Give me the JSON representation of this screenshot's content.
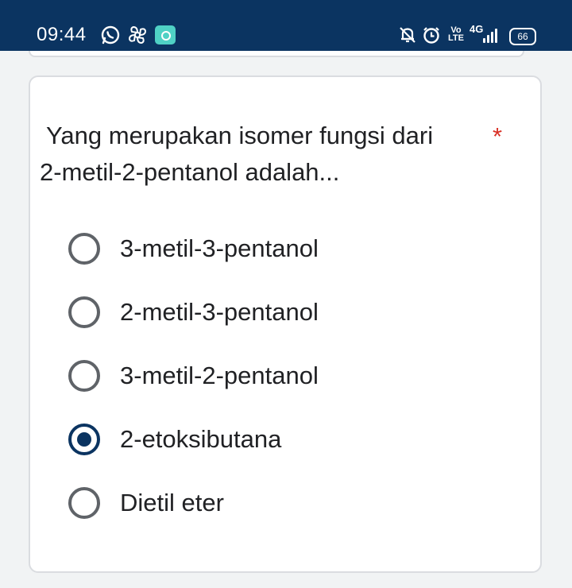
{
  "status_bar": {
    "time": "09:44",
    "left_icons": [
      "whatsapp-icon",
      "pinwheel-icon",
      "app-notification-icon"
    ],
    "right_icons": [
      "mute-bell-icon",
      "alarm-icon",
      "volte-icon",
      "signal-icon",
      "battery-icon"
    ],
    "volte_top": "Vo",
    "volte_bottom": "LTE",
    "network_type": "4G",
    "battery_level": "66"
  },
  "question": {
    "line1": " Yang merupakan isomer fungsi dari",
    "line2": "2-metil-2-pentanol adalah...",
    "required_marker": "*"
  },
  "options": [
    {
      "label": "3-metil-3-pentanol",
      "selected": false
    },
    {
      "label": "2-metil-3-pentanol",
      "selected": false
    },
    {
      "label": "3-metil-2-pentanol",
      "selected": false
    },
    {
      "label": "2-etoksibutana",
      "selected": true
    },
    {
      "label": "Dietil eter",
      "selected": false
    }
  ],
  "colors": {
    "status_bar_bg": "#0b3461",
    "accent": "#0b3461",
    "required": "#d93025",
    "background": "#f1f3f4"
  }
}
